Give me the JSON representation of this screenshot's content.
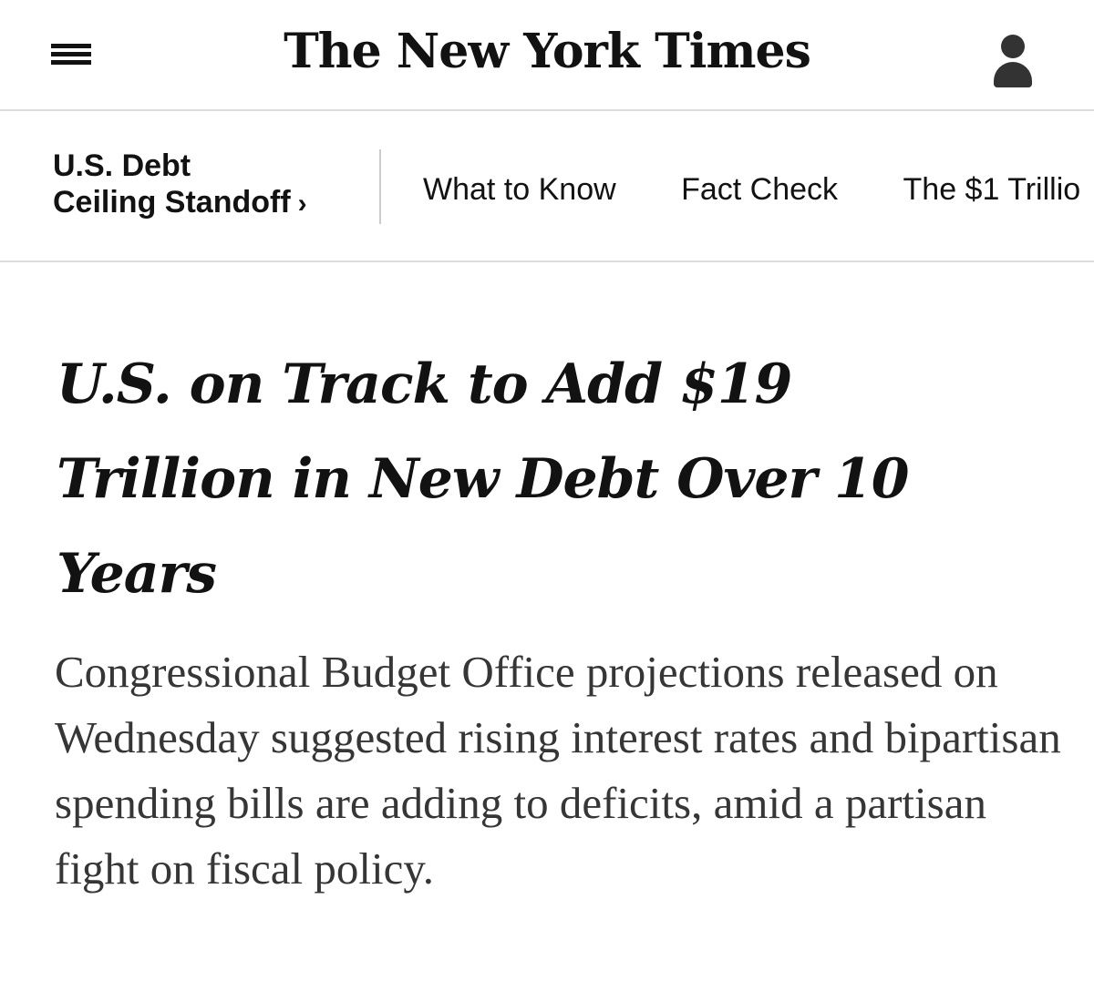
{
  "masthead": {
    "logo_text": "The New York Times",
    "menu_icon": "hamburger-menu-icon",
    "account_icon": "user-account-icon"
  },
  "section_nav": {
    "title_line1": "U.S. Debt",
    "title_line2": "Ceiling Standoff",
    "chevron": "›",
    "links": [
      {
        "label": "What to Know"
      },
      {
        "label": "Fact Check"
      },
      {
        "label": "The $1 Trillio"
      }
    ]
  },
  "article": {
    "headline": "U.S. on Track to Add $19 Trillion in New Debt Over 10 Years",
    "summary": "Congressional Budget Office projections released on Wednesday suggested rising interest rates and bipartisan spending bills are adding to deficits, amid a partisan fight on fiscal policy."
  },
  "colors": {
    "text": "#121212",
    "summary_text": "#363636",
    "divider": "#dcdcdc"
  }
}
